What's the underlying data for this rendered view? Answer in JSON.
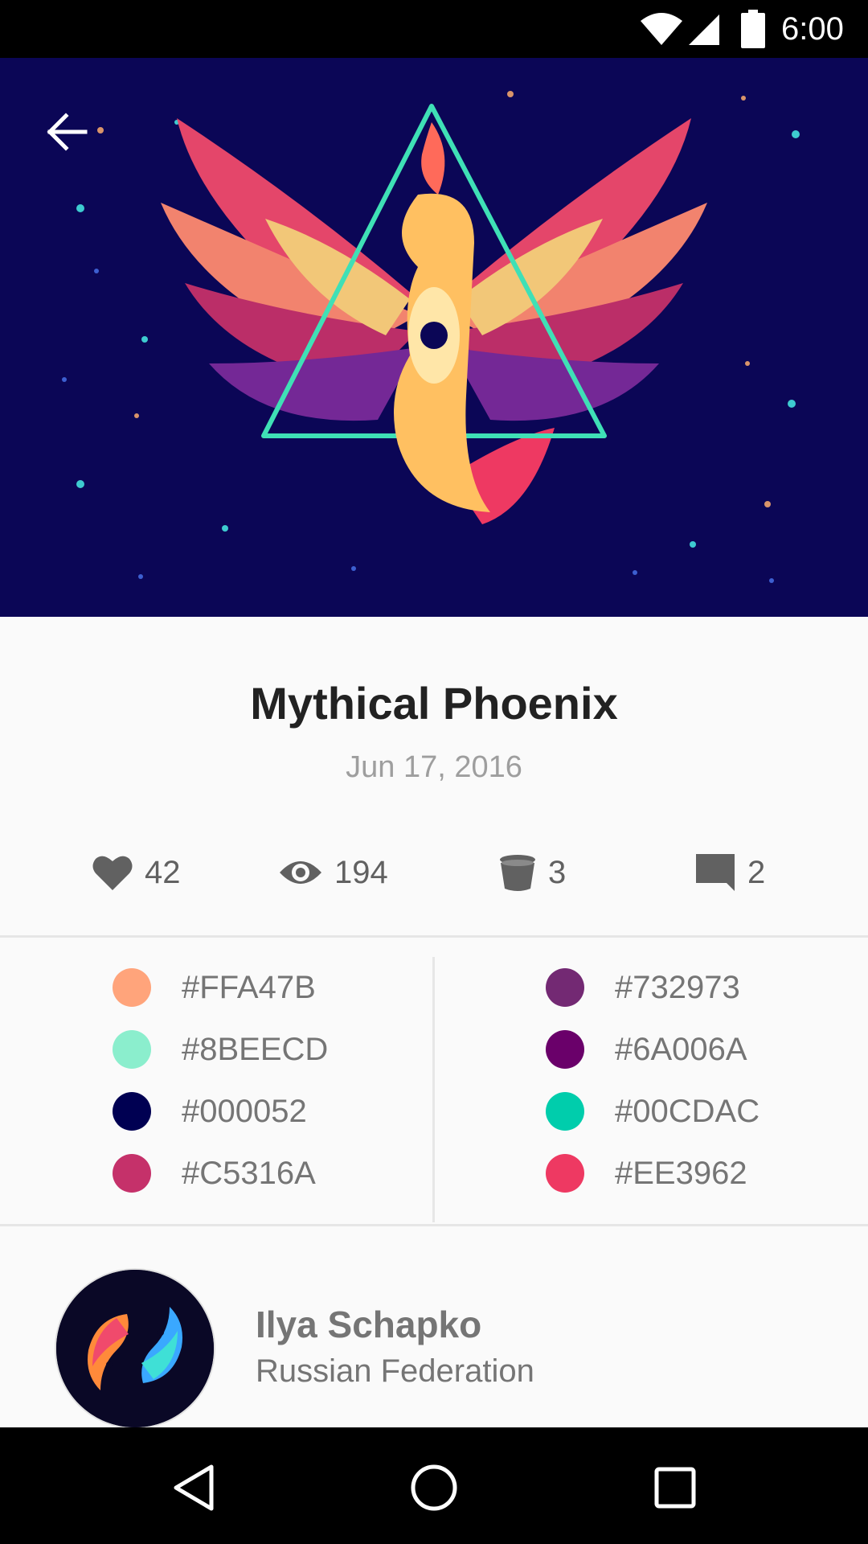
{
  "status_bar": {
    "time": "6:00",
    "icons": [
      "wifi-icon",
      "signal-icon",
      "battery-icon"
    ]
  },
  "hero": {
    "back_icon": "arrow-left-icon",
    "background_color": "#0b0656"
  },
  "shot": {
    "title": "Mythical Phoenix",
    "date": "Jun 17, 2016"
  },
  "stats": {
    "likes": {
      "icon": "heart-icon",
      "count": "42"
    },
    "views": {
      "icon": "eye-icon",
      "count": "194"
    },
    "buckets": {
      "icon": "bucket-icon",
      "count": "3"
    },
    "comments": {
      "icon": "comment-icon",
      "count": "2"
    }
  },
  "palette": {
    "left": [
      {
        "color": "#FFA47B",
        "label": "#FFA47B"
      },
      {
        "color": "#8BEECD",
        "label": "#8BEECD"
      },
      {
        "color": "#000052",
        "label": "#000052"
      },
      {
        "color": "#C5316A",
        "label": "#C5316A"
      }
    ],
    "right": [
      {
        "color": "#732973",
        "label": "#732973"
      },
      {
        "color": "#6A006A",
        "label": "#6A006A"
      },
      {
        "color": "#00CDAC",
        "label": "#00CDAC"
      },
      {
        "color": "#EE3962",
        "label": "#EE3962"
      }
    ]
  },
  "author": {
    "name": "Ilya Schapko",
    "country": "Russian Federation"
  },
  "nav_bar": {
    "buttons": [
      "nav-back-icon",
      "nav-home-icon",
      "nav-recents-icon"
    ]
  }
}
